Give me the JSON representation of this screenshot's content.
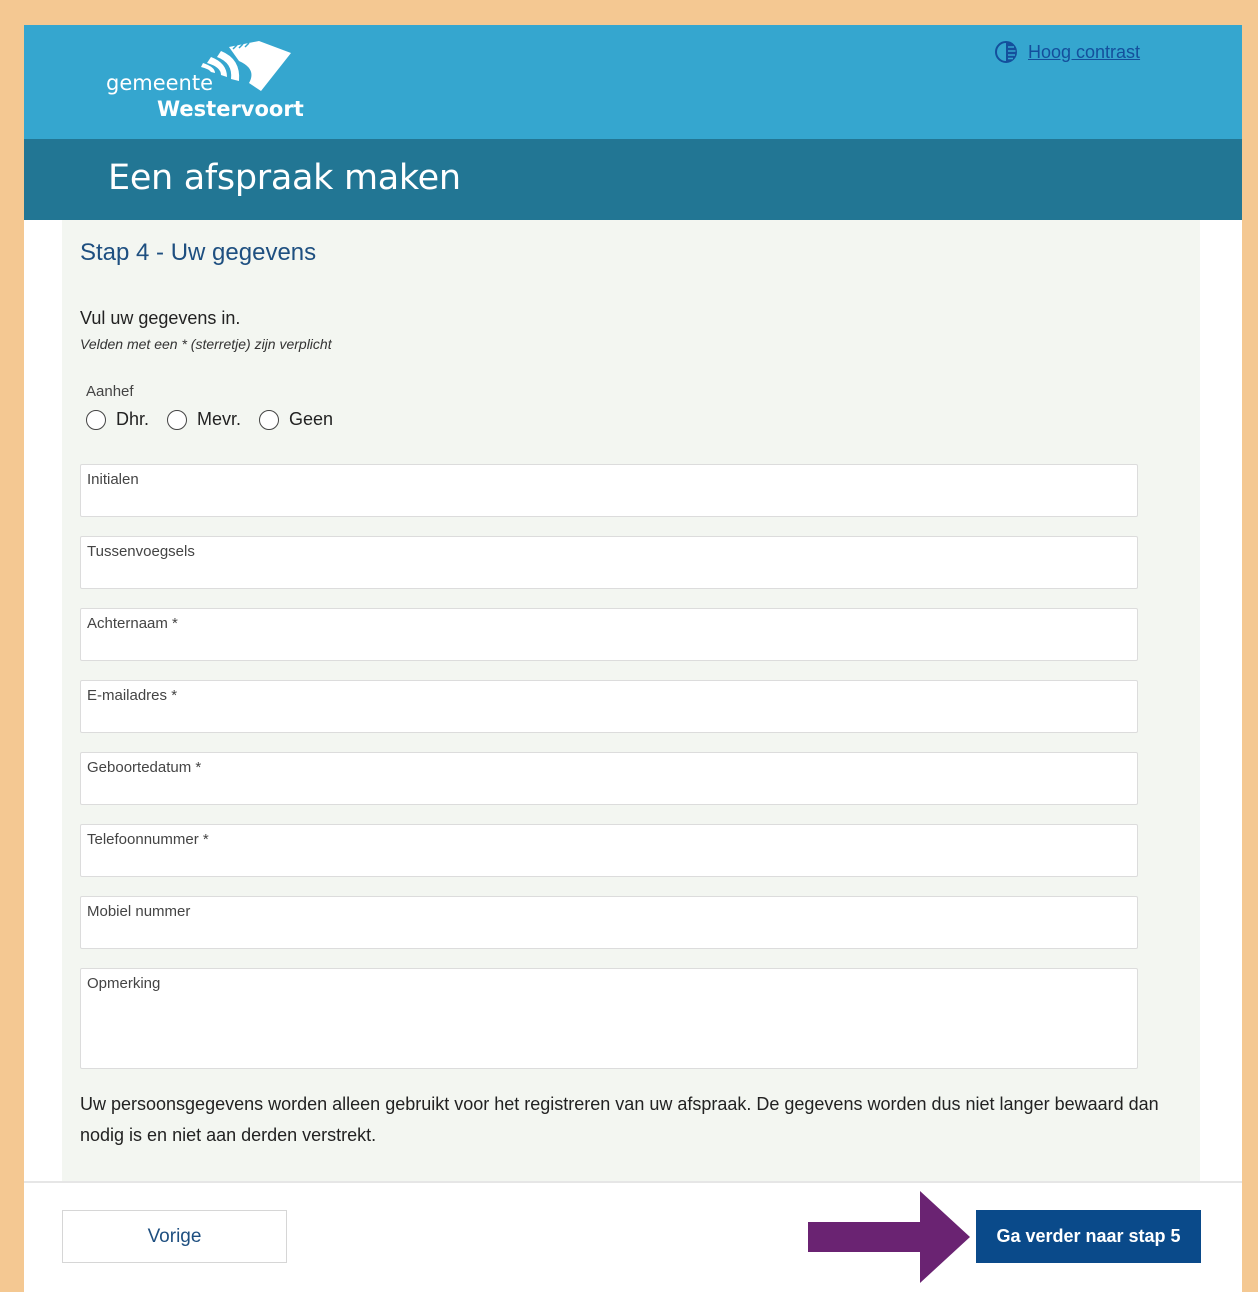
{
  "header": {
    "logo_line1": "gemeente",
    "logo_line2": "Westervoort",
    "contrast_link": "Hoog contrast"
  },
  "page_title": "Een afspraak maken",
  "step": {
    "title": "Stap 4 - Uw gegevens",
    "intro": "Vul uw gegevens in.",
    "hint": "Velden met een * (sterretje) zijn verplicht"
  },
  "salutation": {
    "legend": "Aanhef",
    "options": [
      "Dhr.",
      "Mevr.",
      "Geen"
    ]
  },
  "fields": {
    "initials": "Initialen",
    "infix": "Tussenvoegsels",
    "surname": "Achternaam *",
    "email": "E-mailadres *",
    "birthdate": "Geboortedatum *",
    "phone": "Telefoonnummer *",
    "mobile": "Mobiel nummer",
    "remark": "Opmerking"
  },
  "privacy_text": "Uw persoonsgegevens worden alleen gebruikt voor het registreren van uw afspraak. De gegevens worden dus niet langer bewaard dan nodig is en niet aan derden verstrekt.",
  "footer": {
    "prev_button": "Vorige",
    "next_button": "Ga verder naar stap 5"
  },
  "colors": {
    "page_background": "#f4c892",
    "header_blue": "#35a6cf",
    "title_bar": "#227694",
    "form_background": "#f3f6f1",
    "primary_button": "#0a4a8a",
    "annotation_arrow": "#6a2372"
  },
  "icons": {
    "contrast": "half-circle-contrast-icon",
    "annotation": "arrow-right-icon"
  }
}
